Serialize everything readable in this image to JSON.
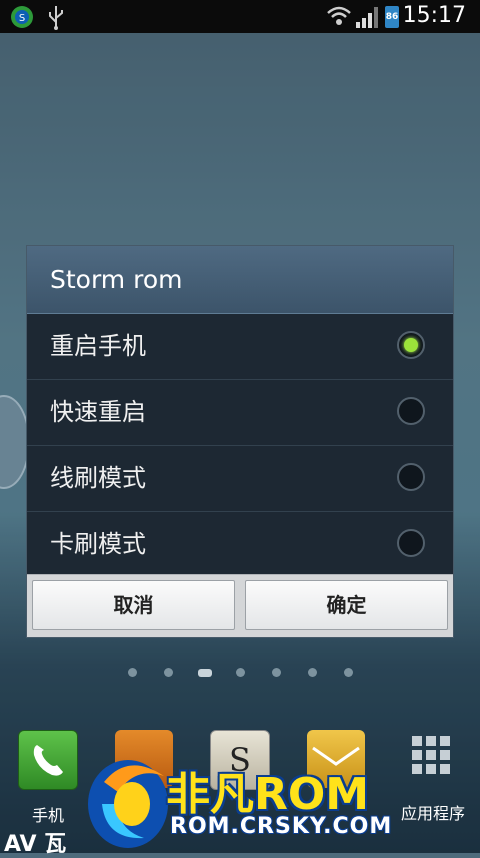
{
  "status_bar": {
    "time": "15:17",
    "battery_level": "86",
    "icons": [
      "app-notification-icon",
      "usb-icon",
      "wifi-icon",
      "signal-icon",
      "battery-icon"
    ]
  },
  "dialog": {
    "title": "Storm rom",
    "options": [
      {
        "label": "重启手机",
        "selected": true
      },
      {
        "label": "快速重启",
        "selected": false
      },
      {
        "label": "线刷模式",
        "selected": false
      },
      {
        "label": "卡刷模式",
        "selected": false
      }
    ],
    "cancel_label": "取消",
    "ok_label": "确定"
  },
  "home": {
    "pages": 7,
    "active_page": 3,
    "dock": [
      {
        "label": "手机",
        "icon": "phone-icon"
      },
      {
        "label": "",
        "icon": "contacts-icon"
      },
      {
        "label": "",
        "icon": "s-app-icon"
      },
      {
        "label": "",
        "icon": "messages-icon"
      },
      {
        "label": "应用程序",
        "icon": "apps-grid-icon"
      }
    ]
  },
  "watermark": {
    "main": "非凡ROM",
    "sub": "ROM.CRSKY.COM",
    "corner": "AV 瓦"
  },
  "colors": {
    "accent_radio": "#9be33a",
    "dialog_bg": "#1e2a35",
    "title_bg": "#4f6a82"
  }
}
